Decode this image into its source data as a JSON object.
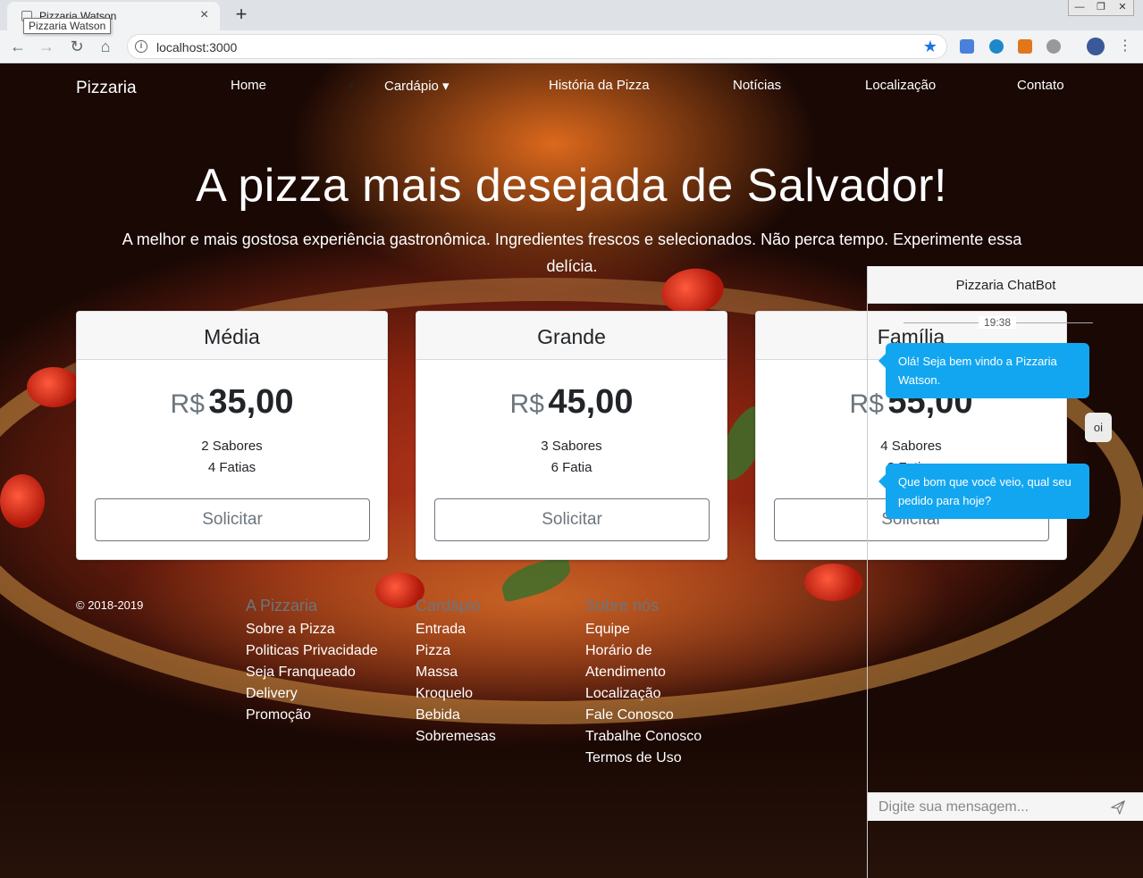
{
  "browser": {
    "tab_title": "Pizzaria Watson",
    "tooltip": "Pizzaria Watson",
    "url": "localhost:3000",
    "new_tab": "+",
    "tab_close": "×",
    "win_min": "—",
    "win_restore": "❐",
    "win_close": "✕",
    "back": "←",
    "forward": "→",
    "reload": "↻",
    "home": "⌂",
    "star": "★",
    "menu": "⋮"
  },
  "navbar": {
    "brand": "Pizzaria",
    "links": [
      "Home",
      "Cardápio",
      "História da Pizza",
      "Notícias",
      "Localização",
      "Contato"
    ],
    "dropdown_caret": "▾"
  },
  "hero": {
    "title": "A pizza mais desejada de Salvador!",
    "subtitle": "A melhor e mais gostosa experiência gastronômica. Ingredientes frescos e selecionados. Não perca tempo. Experimente essa delícia."
  },
  "cards": [
    {
      "name": "Média",
      "currency": "R$",
      "price": "35,00",
      "flavors": "2 Sabores",
      "slices": "4 Fatias",
      "button": "Solicitar"
    },
    {
      "name": "Grande",
      "currency": "R$",
      "price": "45,00",
      "flavors": "3 Sabores",
      "slices": "6 Fatia",
      "button": "Solicitar"
    },
    {
      "name": "Família",
      "currency": "R$",
      "price": "55,00",
      "flavors": "4 Sabores",
      "slices": "8 Fatias",
      "button": "Solicitar"
    }
  ],
  "footer": {
    "copyright": "© 2018-2019",
    "columns": [
      {
        "title": "A Pizzaria",
        "links": [
          "Sobre a Pizza",
          "Politicas Privacidade",
          "Seja Franqueado",
          "Delivery",
          "Promoção"
        ]
      },
      {
        "title": "Cardápio",
        "links": [
          "Entrada",
          "Pizza",
          "Massa",
          "Kroquelo",
          "Bebida",
          "Sobremesas"
        ]
      },
      {
        "title": "Sobre nós",
        "links": [
          "Equipe",
          "Horário de",
          "Atendimento",
          "Localização",
          "Fale Conosco",
          "Trabalhe Conosco",
          "Termos de Uso"
        ]
      }
    ]
  },
  "chat": {
    "title": "Pizzaria ChatBot",
    "time": "19:38",
    "messages": [
      {
        "from": "bot",
        "text": "Olá! Seja bem vindo a Pizzaria Watson."
      },
      {
        "from": "user",
        "text": "oi"
      },
      {
        "from": "bot",
        "text": "Que bom que você veio, qual seu pedido para hoje?"
      }
    ],
    "input_placeholder": "Digite sua mensagem..."
  },
  "colors": {
    "chat_bubble_bot": "#13a6f0",
    "button_border": "#6c757d",
    "brand_text": "#ffffff"
  }
}
